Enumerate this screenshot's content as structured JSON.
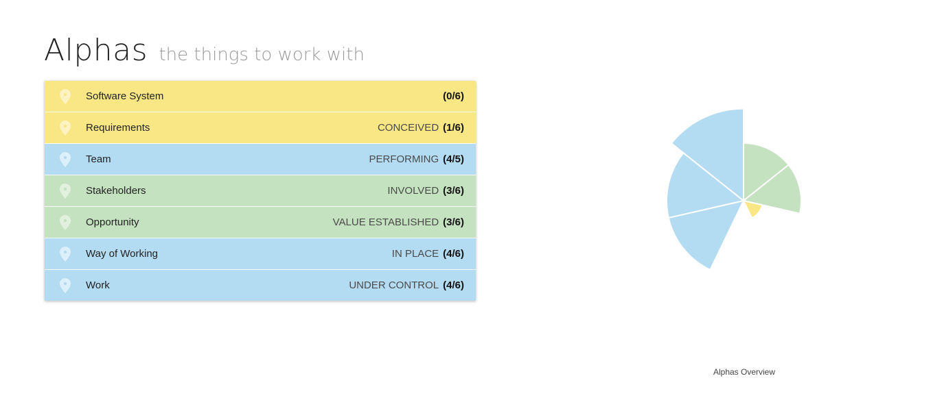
{
  "header": {
    "title": "Alphas",
    "subtitle": "the things to work with"
  },
  "colors": {
    "yellow": "#f8e784",
    "blue": "#b3dbf2",
    "green": "#c5e2c0",
    "pin_yellow": "#fdf3c2",
    "pin_blue": "#dcf0fb",
    "pin_green": "#e1f1de"
  },
  "alphas": [
    {
      "name": "Software System",
      "state": "",
      "count": "(0/6)",
      "color": "yellow",
      "achieved": 0,
      "total": 6
    },
    {
      "name": "Requirements",
      "state": "CONCEIVED",
      "count": "(1/6)",
      "color": "yellow",
      "achieved": 1,
      "total": 6
    },
    {
      "name": "Team",
      "state": "PERFORMING",
      "count": "(4/5)",
      "color": "blue",
      "achieved": 4,
      "total": 5
    },
    {
      "name": "Stakeholders",
      "state": "INVOLVED",
      "count": "(3/6)",
      "color": "green",
      "achieved": 3,
      "total": 6
    },
    {
      "name": "Opportunity",
      "state": "VALUE ESTABLISHED",
      "count": "(3/6)",
      "color": "green",
      "achieved": 3,
      "total": 6
    },
    {
      "name": "Way of Working",
      "state": "IN PLACE",
      "count": "(4/6)",
      "color": "blue",
      "achieved": 4,
      "total": 6
    },
    {
      "name": "Work",
      "state": "UNDER CONTROL",
      "count": "(4/6)",
      "color": "blue",
      "achieved": 4,
      "total": 6
    }
  ],
  "chart_data": {
    "type": "pie",
    "variant": "polar-area",
    "title": "Alphas Overview",
    "start_angle_deg": 0,
    "direction": "clockwise",
    "slices": [
      {
        "category": "Stakeholders",
        "value": 0.5,
        "color": "#c5e2c0"
      },
      {
        "category": "Opportunity",
        "value": 0.5,
        "color": "#c5e2c0"
      },
      {
        "category": "Requirements",
        "value": 0.1667,
        "color": "#f8e784"
      },
      {
        "category": "Software System",
        "value": 0,
        "color": "#f8e784"
      },
      {
        "category": "Work",
        "value": 0.6667,
        "color": "#b3dbf2"
      },
      {
        "category": "Way of Working",
        "value": 0.6667,
        "color": "#b3dbf2"
      },
      {
        "category": "Team",
        "value": 0.8,
        "color": "#b3dbf2"
      }
    ],
    "rmax": 1
  }
}
